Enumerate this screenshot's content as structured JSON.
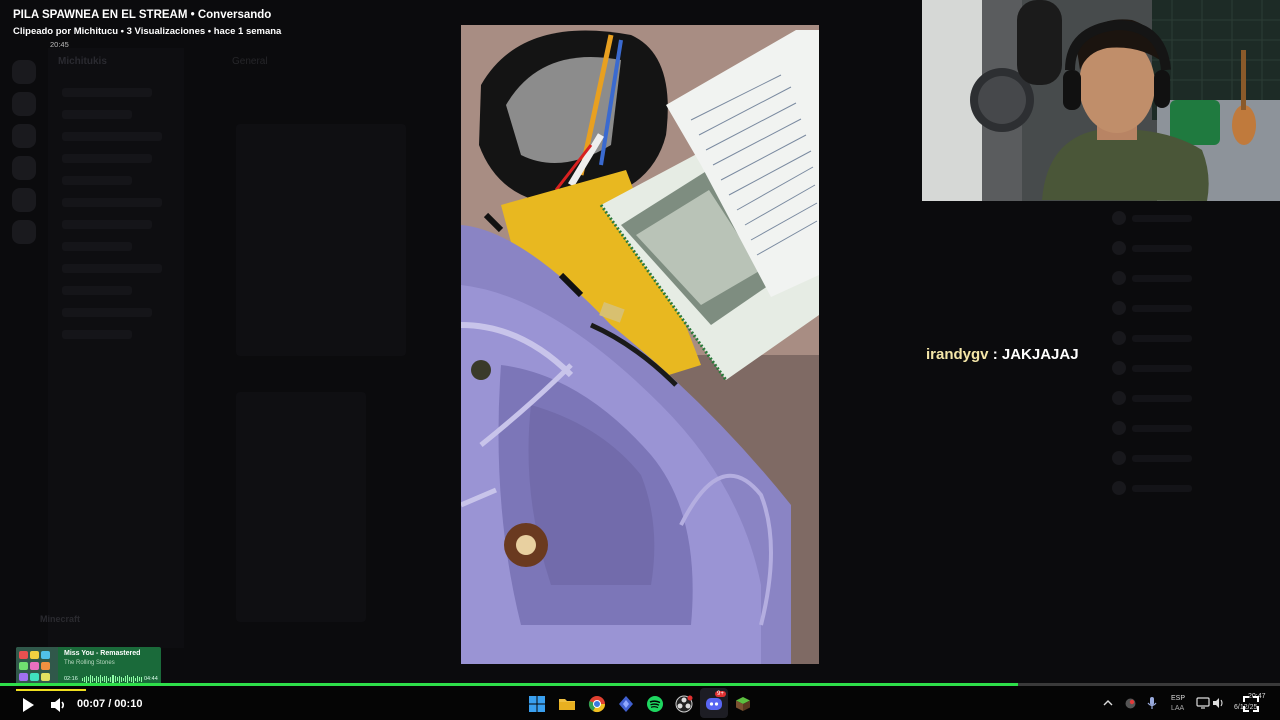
{
  "clip": {
    "title": "PILA SPAWNEA EN EL STREAM • Conversando",
    "meta": "Clipeado por Michitucu • 3 Visualizaciones • hace 1 semana",
    "timestamp": "20:45"
  },
  "background": {
    "server_name": "Michitukis",
    "channel_header": "General",
    "bottom_label": "Minecraft"
  },
  "chat": {
    "username": "irandygv",
    "separator": " : ",
    "message": "JAKJAJAJ"
  },
  "spotify": {
    "track": "Miss You - Remastered",
    "artist": "The Rolling Stones",
    "elapsed": "02:16",
    "duration": "04:44",
    "progress": 0.48
  },
  "player": {
    "time": "00:07 / 00:10",
    "progress": 0.795
  },
  "taskbar": {
    "lang_top": "ESP",
    "lang_bottom": "LAA",
    "clock_time": "20:47",
    "clock_date": "6/12/25",
    "notification_badge": "9+"
  },
  "colors": {
    "accent_green": "#2ee04a",
    "chat_username": "#f4e6a8",
    "spotify_bg": "#1a6a3a"
  }
}
